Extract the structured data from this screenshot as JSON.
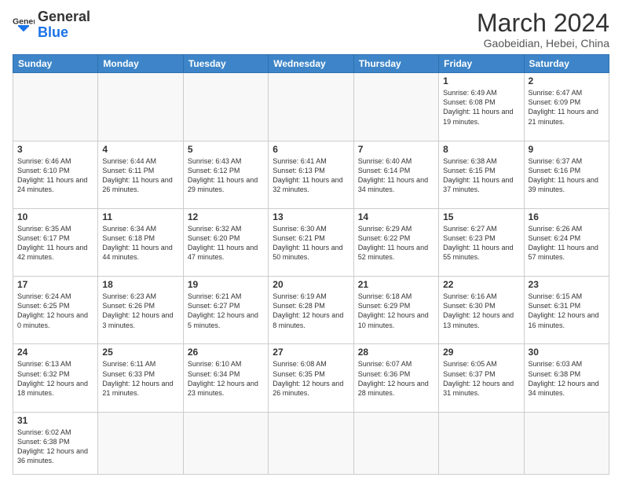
{
  "header": {
    "logo_general": "General",
    "logo_blue": "Blue",
    "month_title": "March 2024",
    "subtitle": "Gaobeidian, Hebei, China"
  },
  "days_of_week": [
    "Sunday",
    "Monday",
    "Tuesday",
    "Wednesday",
    "Thursday",
    "Friday",
    "Saturday"
  ],
  "weeks": [
    [
      {
        "num": "",
        "info": ""
      },
      {
        "num": "",
        "info": ""
      },
      {
        "num": "",
        "info": ""
      },
      {
        "num": "",
        "info": ""
      },
      {
        "num": "",
        "info": ""
      },
      {
        "num": "1",
        "info": "Sunrise: 6:49 AM\nSunset: 6:08 PM\nDaylight: 11 hours and 19 minutes."
      },
      {
        "num": "2",
        "info": "Sunrise: 6:47 AM\nSunset: 6:09 PM\nDaylight: 11 hours and 21 minutes."
      }
    ],
    [
      {
        "num": "3",
        "info": "Sunrise: 6:46 AM\nSunset: 6:10 PM\nDaylight: 11 hours and 24 minutes."
      },
      {
        "num": "4",
        "info": "Sunrise: 6:44 AM\nSunset: 6:11 PM\nDaylight: 11 hours and 26 minutes."
      },
      {
        "num": "5",
        "info": "Sunrise: 6:43 AM\nSunset: 6:12 PM\nDaylight: 11 hours and 29 minutes."
      },
      {
        "num": "6",
        "info": "Sunrise: 6:41 AM\nSunset: 6:13 PM\nDaylight: 11 hours and 32 minutes."
      },
      {
        "num": "7",
        "info": "Sunrise: 6:40 AM\nSunset: 6:14 PM\nDaylight: 11 hours and 34 minutes."
      },
      {
        "num": "8",
        "info": "Sunrise: 6:38 AM\nSunset: 6:15 PM\nDaylight: 11 hours and 37 minutes."
      },
      {
        "num": "9",
        "info": "Sunrise: 6:37 AM\nSunset: 6:16 PM\nDaylight: 11 hours and 39 minutes."
      }
    ],
    [
      {
        "num": "10",
        "info": "Sunrise: 6:35 AM\nSunset: 6:17 PM\nDaylight: 11 hours and 42 minutes."
      },
      {
        "num": "11",
        "info": "Sunrise: 6:34 AM\nSunset: 6:18 PM\nDaylight: 11 hours and 44 minutes."
      },
      {
        "num": "12",
        "info": "Sunrise: 6:32 AM\nSunset: 6:20 PM\nDaylight: 11 hours and 47 minutes."
      },
      {
        "num": "13",
        "info": "Sunrise: 6:30 AM\nSunset: 6:21 PM\nDaylight: 11 hours and 50 minutes."
      },
      {
        "num": "14",
        "info": "Sunrise: 6:29 AM\nSunset: 6:22 PM\nDaylight: 11 hours and 52 minutes."
      },
      {
        "num": "15",
        "info": "Sunrise: 6:27 AM\nSunset: 6:23 PM\nDaylight: 11 hours and 55 minutes."
      },
      {
        "num": "16",
        "info": "Sunrise: 6:26 AM\nSunset: 6:24 PM\nDaylight: 11 hours and 57 minutes."
      }
    ],
    [
      {
        "num": "17",
        "info": "Sunrise: 6:24 AM\nSunset: 6:25 PM\nDaylight: 12 hours and 0 minutes."
      },
      {
        "num": "18",
        "info": "Sunrise: 6:23 AM\nSunset: 6:26 PM\nDaylight: 12 hours and 3 minutes."
      },
      {
        "num": "19",
        "info": "Sunrise: 6:21 AM\nSunset: 6:27 PM\nDaylight: 12 hours and 5 minutes."
      },
      {
        "num": "20",
        "info": "Sunrise: 6:19 AM\nSunset: 6:28 PM\nDaylight: 12 hours and 8 minutes."
      },
      {
        "num": "21",
        "info": "Sunrise: 6:18 AM\nSunset: 6:29 PM\nDaylight: 12 hours and 10 minutes."
      },
      {
        "num": "22",
        "info": "Sunrise: 6:16 AM\nSunset: 6:30 PM\nDaylight: 12 hours and 13 minutes."
      },
      {
        "num": "23",
        "info": "Sunrise: 6:15 AM\nSunset: 6:31 PM\nDaylight: 12 hours and 16 minutes."
      }
    ],
    [
      {
        "num": "24",
        "info": "Sunrise: 6:13 AM\nSunset: 6:32 PM\nDaylight: 12 hours and 18 minutes."
      },
      {
        "num": "25",
        "info": "Sunrise: 6:11 AM\nSunset: 6:33 PM\nDaylight: 12 hours and 21 minutes."
      },
      {
        "num": "26",
        "info": "Sunrise: 6:10 AM\nSunset: 6:34 PM\nDaylight: 12 hours and 23 minutes."
      },
      {
        "num": "27",
        "info": "Sunrise: 6:08 AM\nSunset: 6:35 PM\nDaylight: 12 hours and 26 minutes."
      },
      {
        "num": "28",
        "info": "Sunrise: 6:07 AM\nSunset: 6:36 PM\nDaylight: 12 hours and 28 minutes."
      },
      {
        "num": "29",
        "info": "Sunrise: 6:05 AM\nSunset: 6:37 PM\nDaylight: 12 hours and 31 minutes."
      },
      {
        "num": "30",
        "info": "Sunrise: 6:03 AM\nSunset: 6:38 PM\nDaylight: 12 hours and 34 minutes."
      }
    ],
    [
      {
        "num": "31",
        "info": "Sunrise: 6:02 AM\nSunset: 6:38 PM\nDaylight: 12 hours and 36 minutes."
      },
      {
        "num": "",
        "info": ""
      },
      {
        "num": "",
        "info": ""
      },
      {
        "num": "",
        "info": ""
      },
      {
        "num": "",
        "info": ""
      },
      {
        "num": "",
        "info": ""
      },
      {
        "num": "",
        "info": ""
      }
    ]
  ]
}
